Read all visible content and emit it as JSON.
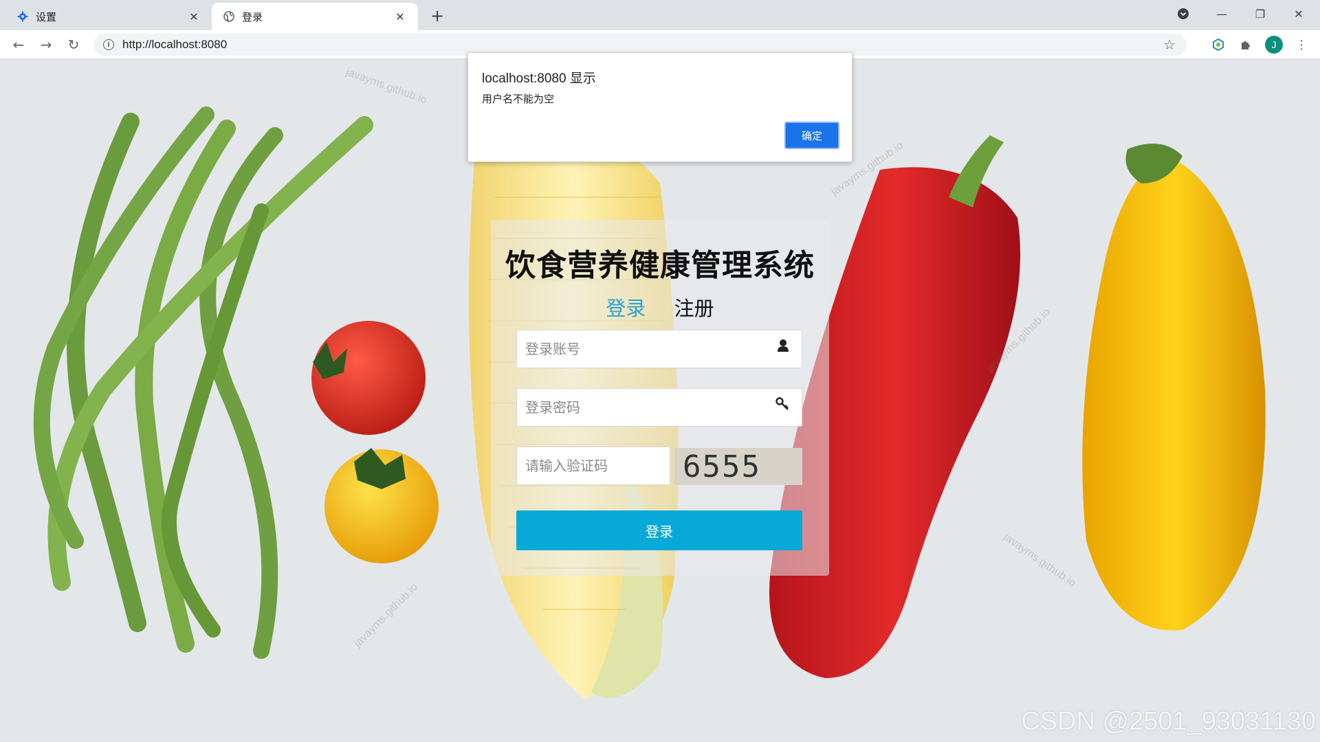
{
  "browser": {
    "tabs": [
      {
        "title": "设置",
        "icon": "gear-icon",
        "active": false
      },
      {
        "title": "登录",
        "icon": "globe-icon",
        "active": true
      }
    ],
    "url": "http://localhost:8080",
    "profile_initial": "J"
  },
  "alert": {
    "title": "localhost:8080 显示",
    "message": "用户名不能为空",
    "ok_label": "确定"
  },
  "login": {
    "system_title": "饮食营养健康管理系统",
    "tab_login": "登录",
    "tab_register": "注册",
    "account_placeholder": "登录账号",
    "password_placeholder": "登录密码",
    "captcha_placeholder": "请输入验证码",
    "captcha_text": "6555",
    "submit_label": "登录"
  },
  "watermark": "CSDN @2501_93031130",
  "colors": {
    "accent_tab": "#29a3d6",
    "button": "#08a9d8",
    "dialog_button": "#1a73e8"
  }
}
